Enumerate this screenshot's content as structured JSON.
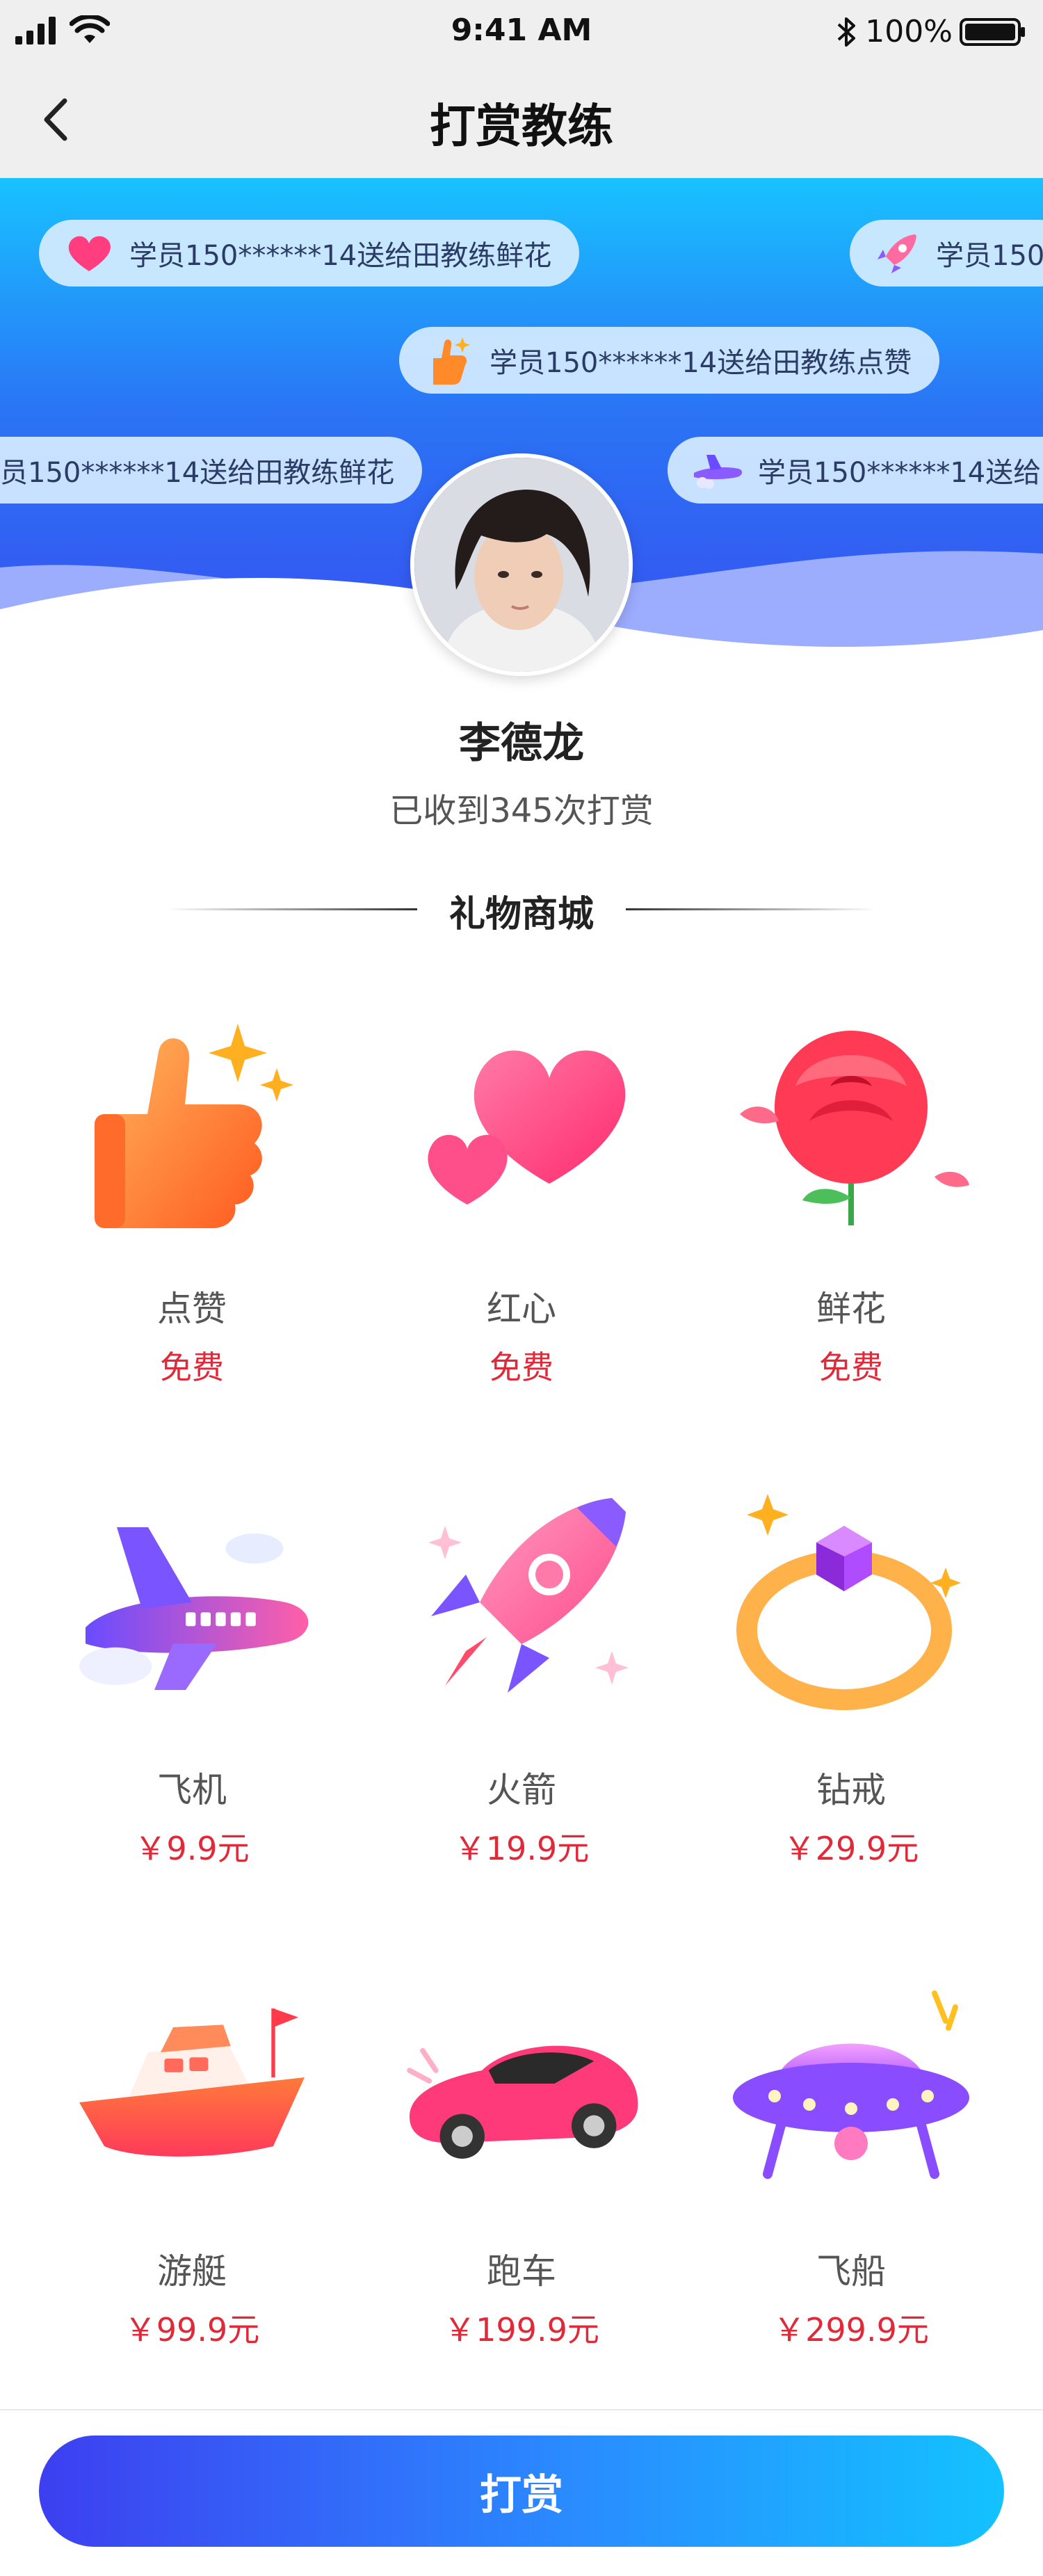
{
  "status_bar": {
    "time": "9:41 AM",
    "battery": "100%"
  },
  "nav": {
    "title": "打赏教练",
    "back_icon": "chevron-left-icon"
  },
  "danmu": [
    {
      "text": "学员150******14送给田教练鲜花",
      "icon": "heart-icon"
    },
    {
      "text": "学员150",
      "icon": "rocket-icon"
    },
    {
      "text": "学员150******14送给田教练点赞",
      "icon": "thumbs-up-icon"
    },
    {
      "text": "员150******14送给田教练鲜花",
      "icon": ""
    },
    {
      "text": "学员150******14送给田",
      "icon": "airplane-icon"
    }
  ],
  "coach": {
    "name": "李德龙",
    "tip_count": "已收到345次打赏"
  },
  "section": {
    "title": "礼物商城"
  },
  "gifts": [
    {
      "name": "点赞",
      "price": "免费",
      "icon": "thumbs-up-icon"
    },
    {
      "name": "红心",
      "price": "免费",
      "icon": "heart-icon"
    },
    {
      "name": "鲜花",
      "price": "免费",
      "icon": "rose-icon"
    },
    {
      "name": "飞机",
      "price": "￥9.9元",
      "icon": "airplane-icon"
    },
    {
      "name": "火箭",
      "price": "￥19.9元",
      "icon": "rocket-icon"
    },
    {
      "name": "钻戒",
      "price": "￥29.9元",
      "icon": "diamond-ring-icon"
    },
    {
      "name": "游艇",
      "price": "￥99.9元",
      "icon": "yacht-icon"
    },
    {
      "name": "跑车",
      "price": "￥199.9元",
      "icon": "sports-car-icon"
    },
    {
      "name": "飞船",
      "price": "￥299.9元",
      "icon": "ufo-icon"
    }
  ],
  "action": {
    "tip_button": "打赏"
  },
  "colors": {
    "primary_gradient_start": "#3d3ff0",
    "primary_gradient_end": "#13c2ff",
    "price_red": "#e02a3a"
  }
}
